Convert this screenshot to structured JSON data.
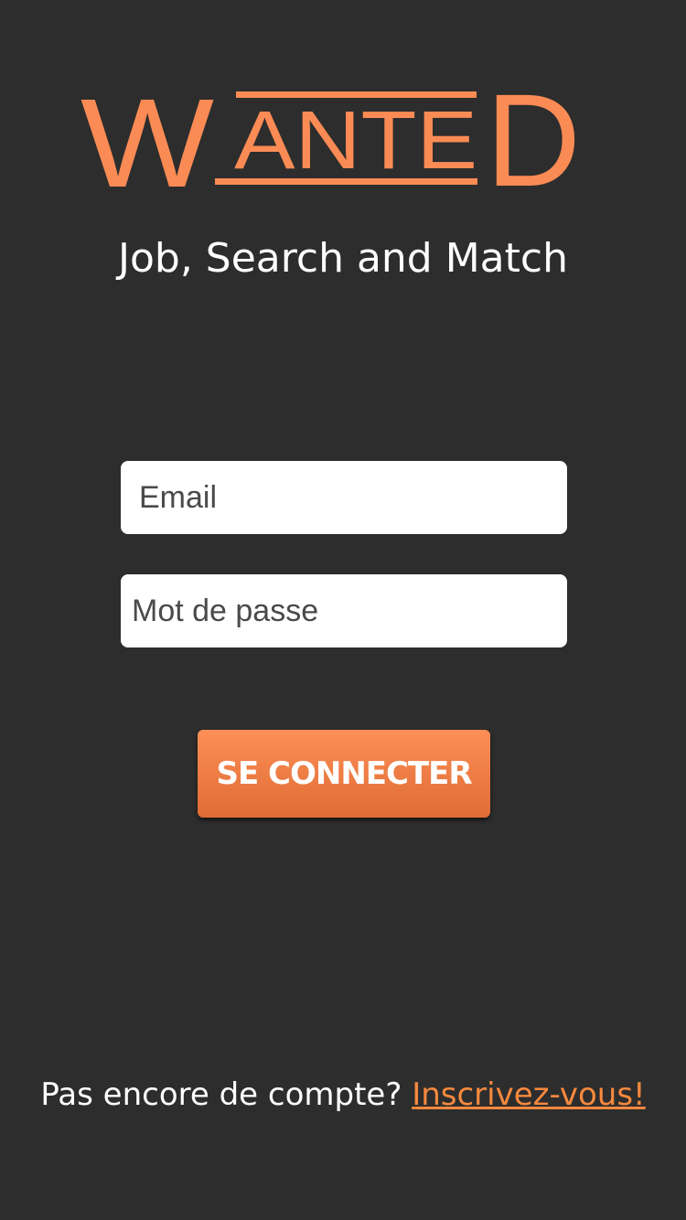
{
  "logo": {
    "text": "WANTED",
    "letter_w": "W",
    "letters_middle": "ANTE",
    "letter_d": "D",
    "color": "#fb8b54"
  },
  "tagline": "Job, Search and Match",
  "form": {
    "email_placeholder": "Email",
    "password_placeholder": "Mot de passe",
    "submit_label": "SE CONNECTER"
  },
  "signup": {
    "prompt": "Pas encore de compte?",
    "link_label": "Inscrivez-vous!"
  },
  "colors": {
    "background": "#2d2d2d",
    "accent": "#fb8b54",
    "link": "#f7893e",
    "text": "#ffffff"
  }
}
